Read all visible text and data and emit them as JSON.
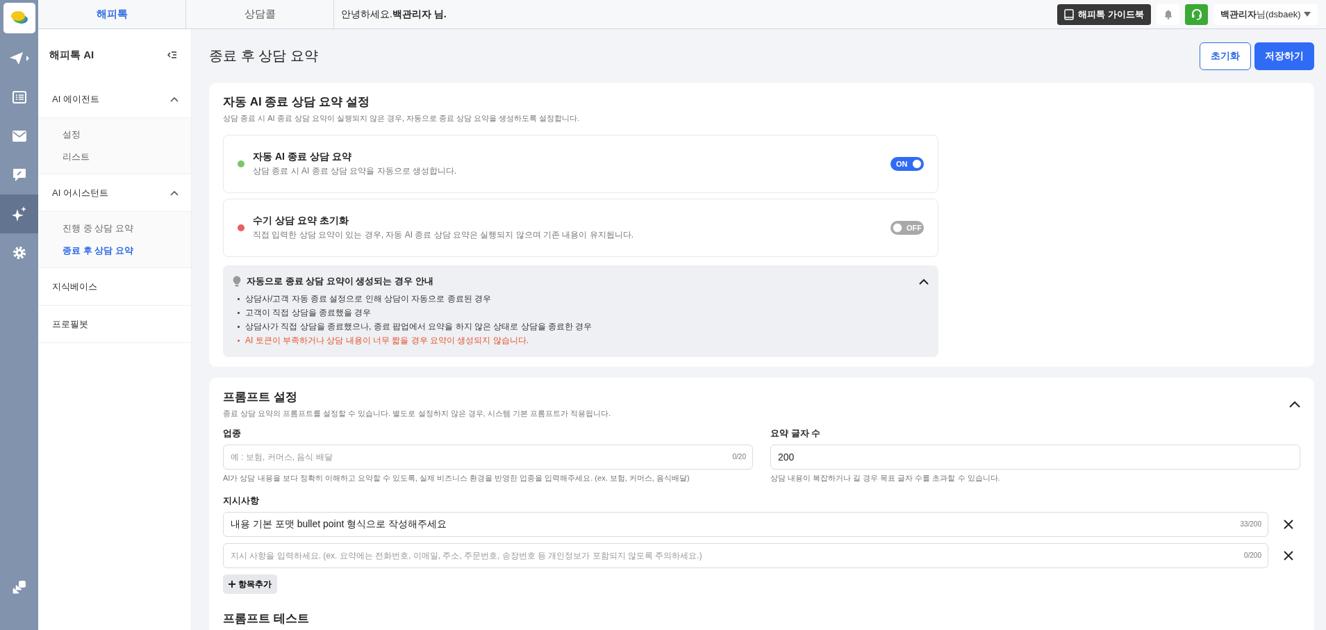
{
  "top_tabs": [
    {
      "label": "해피톡",
      "selected": true
    },
    {
      "label": "상담콜",
      "selected": false
    }
  ],
  "greeting": "안녕하세요.**백관리자 님.**",
  "guide_button": "해피톡 가이드북",
  "user_menu": "**백관리자**님(dsbaek)",
  "rail": [
    {
      "selected": false
    },
    {
      "selected": false
    },
    {
      "selected": false
    },
    {
      "selected": false
    },
    {
      "selected": true
    },
    {
      "selected": false
    }
  ],
  "sidebar": {
    "title": "해피톡 AI",
    "items": [
      {
        "label": "AI 에이전트",
        "expanded": true,
        "children": [
          {
            "label": "설정",
            "selected": false
          },
          {
            "label": "리스트",
            "selected": false
          }
        ]
      },
      {
        "label": "AI 어시스턴트",
        "expanded": true,
        "children": [
          {
            "label": "진행 중 상담 요약",
            "selected": false
          },
          {
            "label": "종료 후 상담 요약",
            "selected": true
          }
        ]
      },
      {
        "label": "지식베이스"
      },
      {
        "label": "프로필봇"
      }
    ]
  },
  "page_title": "종료 후 상담 요약",
  "actions": [
    {
      "label": "초기화",
      "kind": "outline"
    },
    {
      "label": "저장하기",
      "kind": "primary"
    }
  ],
  "auto_section": {
    "title": "자동 AI 종료 상담 요약 설정",
    "description": "상담 종료 시 AI 종료 상담 요약이 실행되지 않은 경우, 자동으로 종료 상담 요약을 생성하도록 설정합니다.",
    "settings": [
      {
        "title": "자동 AI 종료 상담 요약",
        "description": "상담 종료 시 AI 종료 상담 요약을 자동으로 생성합니다.",
        "color": "#7cc66a",
        "on": true,
        "toggle_label": "ON"
      },
      {
        "title": "수기 상담 요약 초기화",
        "description": "직접 입력한 상담 요약이 있는 경우, 자동 AI 종료 상담 요약은 실행되지 않으며 기존 내용이 유지됩니다.",
        "color": "#e8605f",
        "on": false,
        "toggle_label": "OFF"
      }
    ],
    "guide": {
      "title": "자동으로 종료 상담 요약이 생성되는 경우 안내",
      "expanded": true,
      "items": [
        {
          "text": "상담사/고객 자동 종료 설정으로 인해 상담이 자동으로 종료된 경우",
          "kind": "normal"
        },
        {
          "text": "고객이 직접 상담을 종료했을 경우",
          "kind": "normal"
        },
        {
          "text": "상담사가 직접 상담을 종료했으나, 종료 팝업에서 요약을 하지 않은 상태로 상담을 종료한 경우",
          "kind": "normal"
        },
        {
          "text": "AI 토큰이 부족하거나 상담 내용이 너무 짧을 경우 요약이 생성되지 않습니다.",
          "kind": "warning"
        }
      ]
    }
  },
  "prompt_section": {
    "title": "프롬프트 설정",
    "description": "종료 상담 요약의 프롬프트를 설정할 수 있습니다. 별도로 설정하지 않은 경우, 시스템 기본 프롬프트가 적용됩니다.",
    "expanded": true,
    "industry": {
      "label": "업종",
      "placeholder": "예 : 보험, 커머스, 음식 배달",
      "counter": "0/20",
      "hint": "AI가 상담 내용을 보다 정확히 이해하고 요약할 수 있도록, 실제 비즈니스 환경을 반영한 업종을 입력해주세요. (ex. 보험, 커머스, 음식배달)"
    },
    "length": {
      "label": "요약 글자 수",
      "value": "200",
      "hint": "상담 내용이 복잡하거나 길 경우 목표 글자 수를 초과할 수 있습니다."
    },
    "instructions_label": "지시사항",
    "instructions": [
      {
        "value": "내용 기본 포맷 bullet point 형식으로 작성해주세요",
        "counter": "33/200"
      },
      {
        "placeholder": "지시 사항을 입력하세요. (ex. 요약에는 전화번호, 이메일, 주소, 주문번호, 송장번호 등 개인정보가 포함되지 않도록 주의하세요.)",
        "counter": "0/200"
      }
    ],
    "add_button": "항목추가"
  },
  "next_section_title": "프롬프트 테스트"
}
